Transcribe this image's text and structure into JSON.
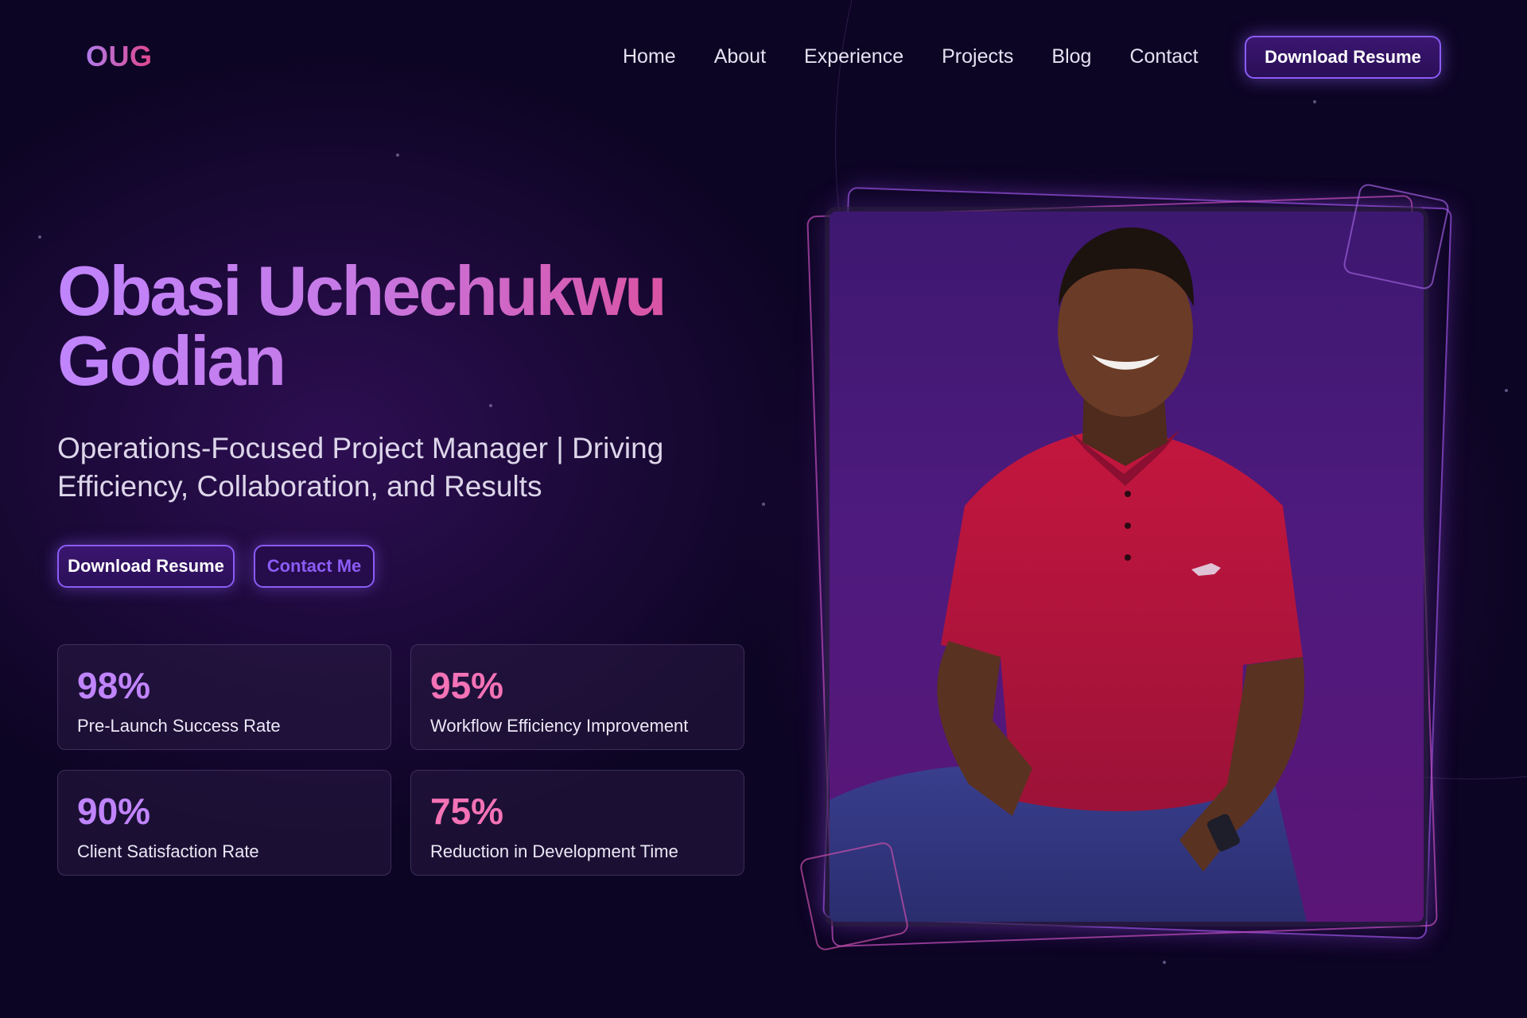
{
  "nav": {
    "logo": "OUG",
    "links": [
      "Home",
      "About",
      "Experience",
      "Projects",
      "Blog",
      "Contact"
    ],
    "cta_label": "Download Resume"
  },
  "hero": {
    "title_line1": "Obasi Uchechukwu",
    "title_line2": "Godian",
    "subtitle_line1": "Operations-Focused Project Manager | Driving",
    "subtitle_line2": "Efficiency, Collaboration, and Results",
    "primary_button": "Download Resume",
    "secondary_button": "Contact Me"
  },
  "stats": [
    {
      "value": "98%",
      "label": "Pre-Launch Success Rate",
      "color": "#c084fc"
    },
    {
      "value": "95%",
      "label": "Workflow Efficiency Improvement",
      "color": "#f472b6"
    },
    {
      "value": "90%",
      "label": "Client Satisfaction Rate",
      "color": "#c084fc"
    },
    {
      "value": "75%",
      "label": "Reduction in Development Time",
      "color": "#f472b6"
    }
  ],
  "colors": {
    "background": "#0d0524",
    "accent_purple": "#8b5cf6",
    "gradient_start": "#c084fc",
    "gradient_end": "#e0468e",
    "shirt": "#b0153e"
  }
}
